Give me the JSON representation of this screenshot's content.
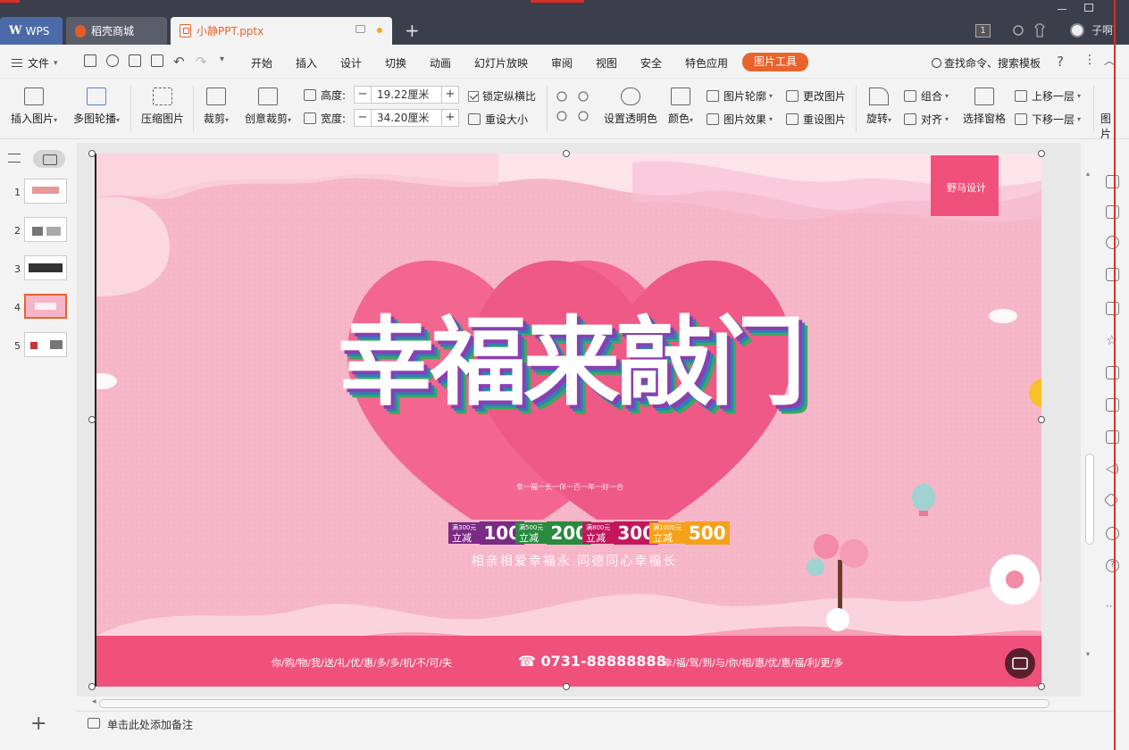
{
  "titlebar": {
    "tabs": [
      {
        "label": "WPS"
      },
      {
        "label": "稻壳商城"
      },
      {
        "label": "小静PPT.pptx"
      }
    ],
    "page_badge": "1",
    "user_name": "子啊"
  },
  "menubar": {
    "file": "文件",
    "items": [
      "开始",
      "插入",
      "设计",
      "切换",
      "动画",
      "幻灯片放映",
      "审阅",
      "视图",
      "安全",
      "特色应用"
    ],
    "active_tab": "图片工具",
    "search": "查找命令、搜索模板",
    "help": "?"
  },
  "ribbon": {
    "insert_picture": "插入图片",
    "multi_carousel": "多图轮播",
    "compress": "压缩图片",
    "crop": "裁剪",
    "creative_crop": "创意裁剪",
    "height_label": "高度:",
    "height_value": "19.22厘米",
    "width_label": "宽度:",
    "width_value": "34.20厘米",
    "lock_ratio": "锁定纵横比",
    "lock_ratio_checked": true,
    "reset_size": "重设大小",
    "set_transparent": "设置透明色",
    "color": "颜色",
    "outline": "图片轮廓",
    "effects": "图片效果",
    "change_picture": "更改图片",
    "reset_picture": "重设图片",
    "rotate": "旋转",
    "group": "组合",
    "align": "对齐",
    "selection_pane": "选择窗格",
    "bring_forward": "上移一层",
    "send_backward": "下移一层",
    "more": "图片"
  },
  "slides": {
    "numbers": [
      "1",
      "2",
      "3",
      "4",
      "5"
    ],
    "selected": 4
  },
  "slide": {
    "headline": "幸福来敲门",
    "subtitle_small": "幸一福一长一伴一百一年一好一合",
    "promos": [
      {
        "small": "满300元",
        "label": "立减",
        "amount": "100",
        "color": "#7b2a86"
      },
      {
        "small": "满500元",
        "label": "立减",
        "amount": "200",
        "color": "#2a8a3e"
      },
      {
        "small": "满800元",
        "label": "立减",
        "amount": "300",
        "color": "#c2185b"
      },
      {
        "small": "满1000元",
        "label": "立减",
        "amount": "500",
        "color": "#f5a21a"
      }
    ],
    "tagline": "相亲相爱幸福永 同德同心幸福长",
    "footer_left": "你/购/物/我/送/礼/优/惠/多/多/机/不/可/失",
    "phone": "☎ 0731-88888888",
    "footer_right": "幸/福/驾/到/与/你/相/惠/优/惠/福/利/更/多",
    "logo_text": "野马设计"
  },
  "notes": {
    "placeholder": "单击此处添加备注"
  },
  "colors": {
    "accent": "#e8642c",
    "tabbar": "#3b3f4c",
    "slide_bg": "#f7b9cb",
    "footer_band": "#f0517c"
  }
}
